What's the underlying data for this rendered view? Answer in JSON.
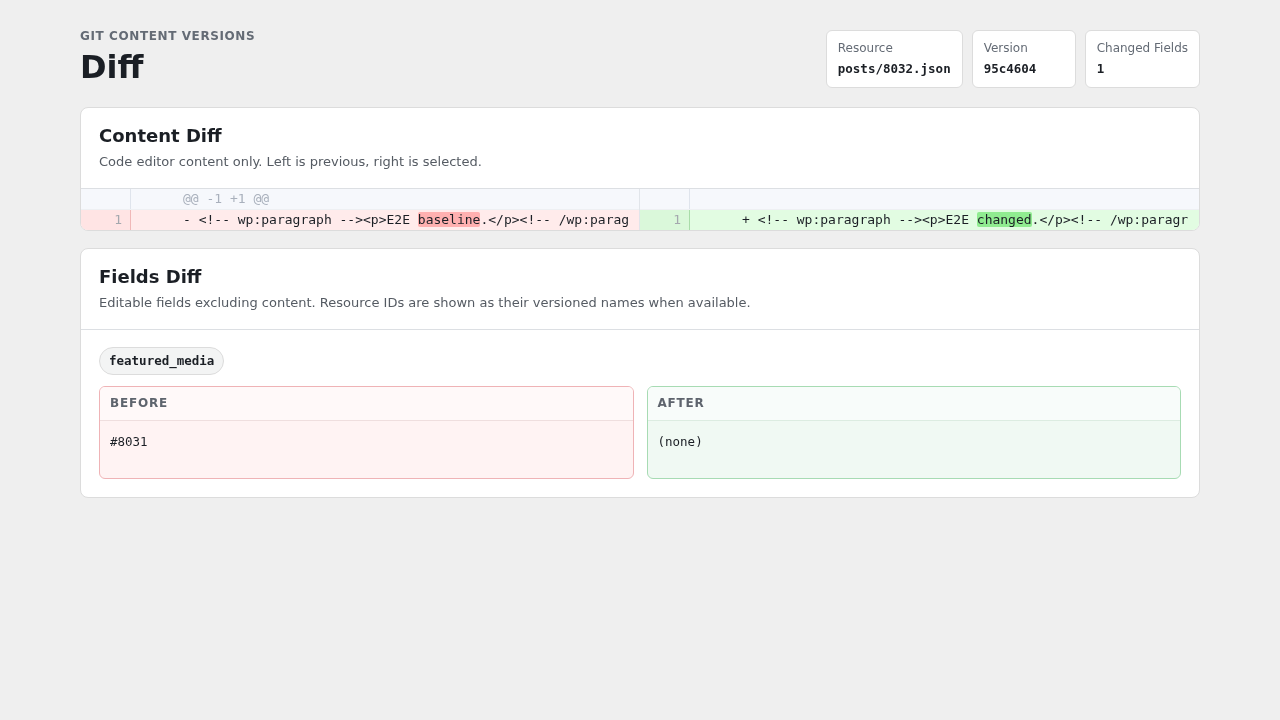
{
  "header": {
    "eyebrow": "GIT CONTENT VERSIONS",
    "title": "Diff"
  },
  "stats": [
    {
      "label": "Resource",
      "value": "posts/8032.json"
    },
    {
      "label": "Version",
      "value": "95c4604"
    },
    {
      "label": "Changed Fields",
      "value": "1"
    }
  ],
  "content_diff": {
    "title": "Content Diff",
    "description": "Code editor content only. Left is previous, right is selected.",
    "panes": [
      {
        "hunk_header": "@@ -1 +1 @@",
        "lines": [
          {
            "kind": "removed",
            "number": "1",
            "segments": [
              {
                "text": "- <!-- wp:paragraph --><p>E2E ",
                "highlight": false
              },
              {
                "text": "baseline",
                "highlight": true
              },
              {
                "text": ".</p><!-- /wp:parag",
                "highlight": false
              }
            ]
          }
        ]
      },
      {
        "lines": [
          {
            "kind": "added",
            "number": "1",
            "segments": [
              {
                "text": "+ <!-- wp:paragraph --><p>E2E ",
                "highlight": false
              },
              {
                "text": "changed",
                "highlight": true
              },
              {
                "text": ".</p><!-- /wp:paragr",
                "highlight": false
              }
            ]
          }
        ]
      }
    ]
  },
  "fields_diff": {
    "title": "Fields Diff",
    "description": "Editable fields excluding content. Resource IDs are shown as their versioned names when available.",
    "fields": [
      {
        "name": "featured_media",
        "sides": [
          {
            "kind": "removed",
            "label": "BEFORE",
            "value": "#8031"
          },
          {
            "kind": "added",
            "label": "AFTER",
            "value": "(none)"
          }
        ]
      }
    ]
  }
}
